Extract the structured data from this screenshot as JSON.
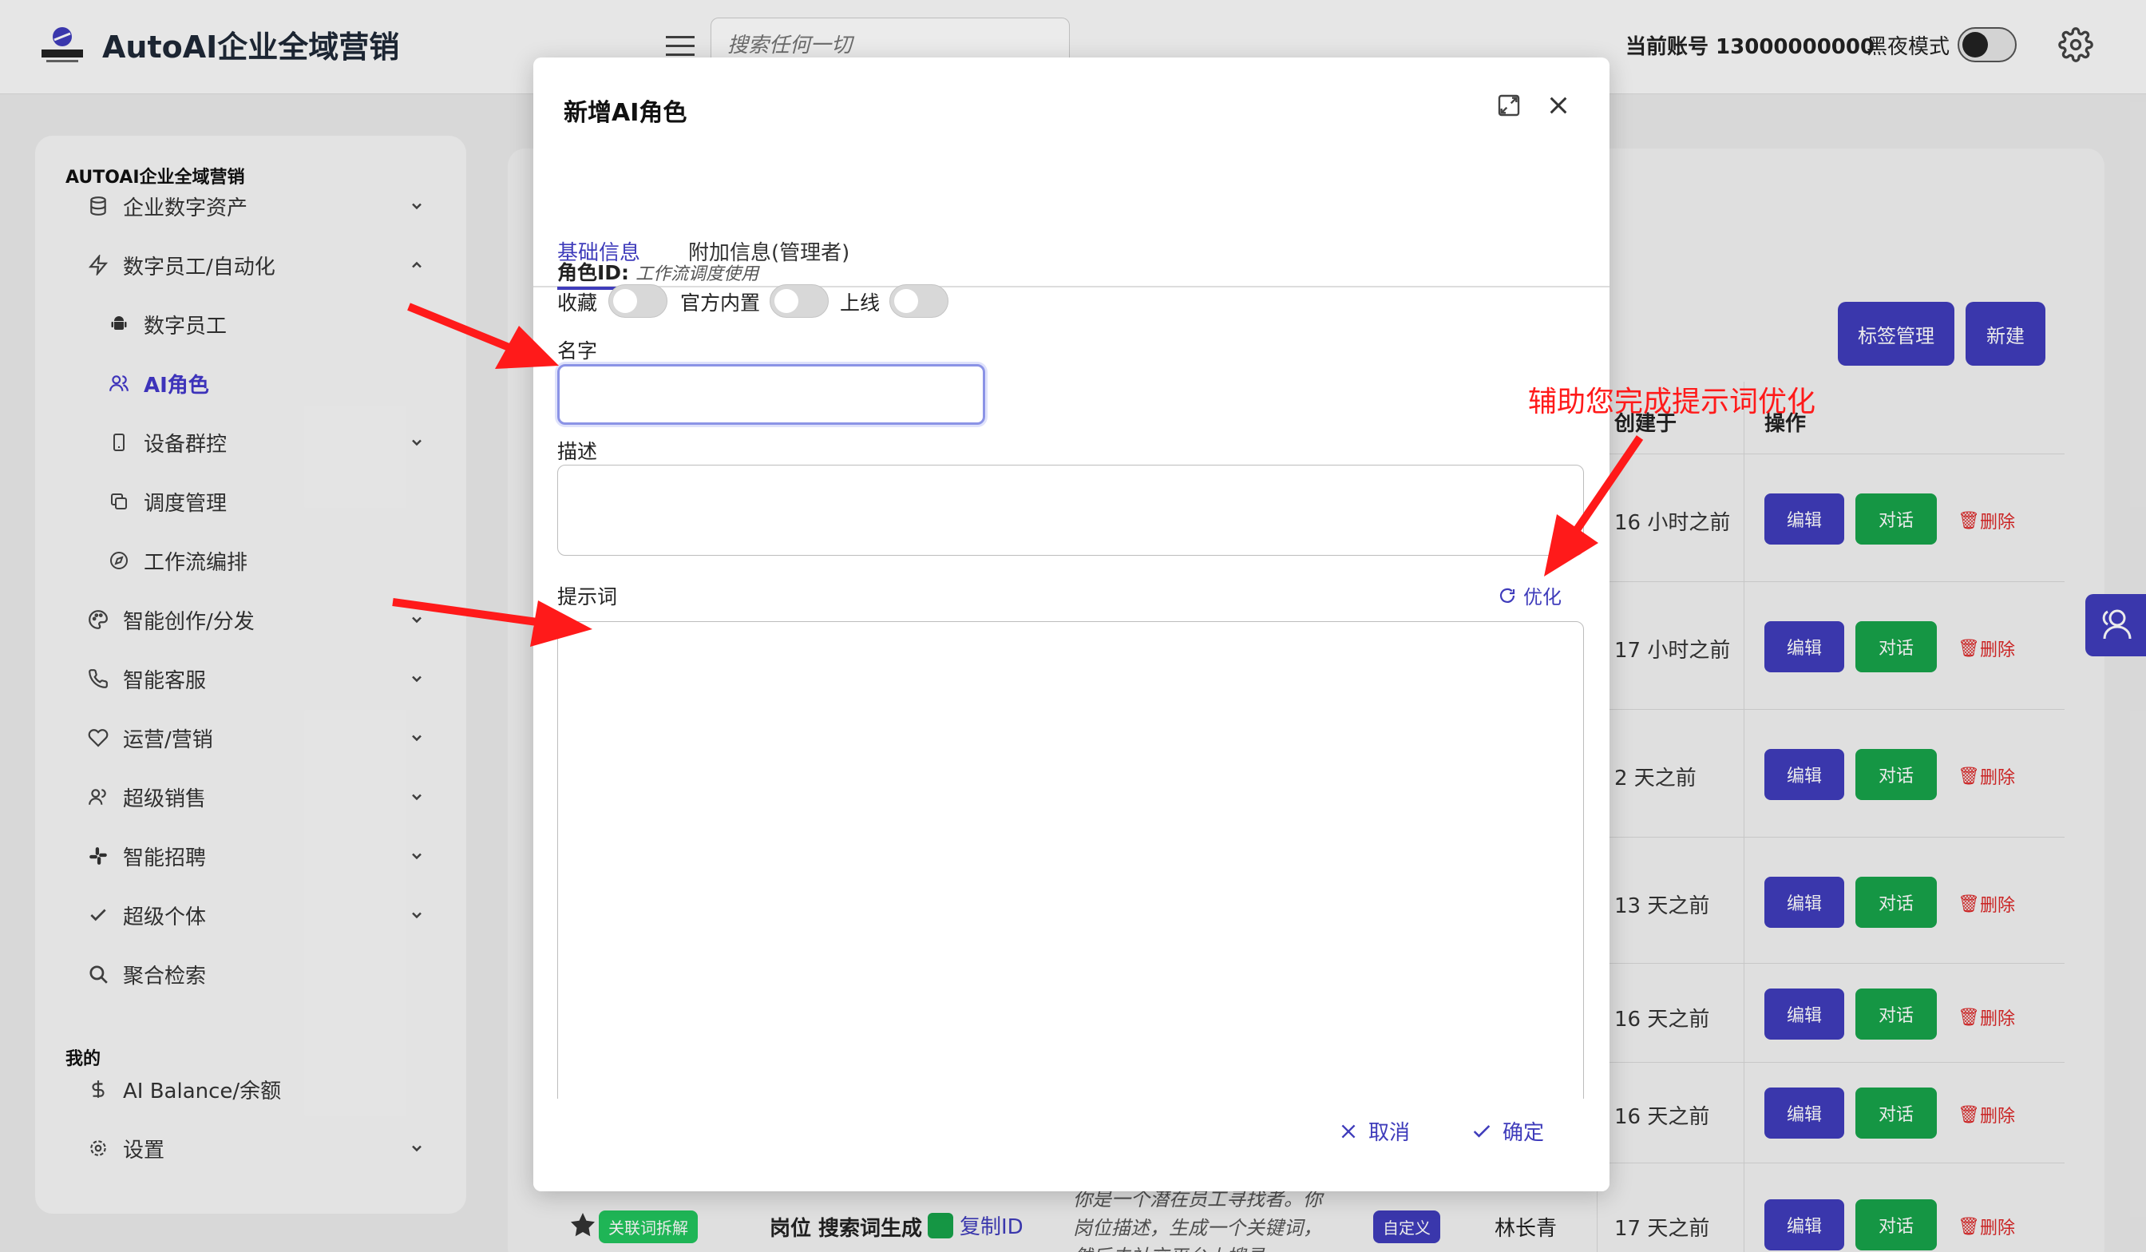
{
  "header": {
    "app_title": "AutoAI企业全域营销",
    "search_placeholder": "搜索任何一切",
    "account_label": "当前账号 13000000000",
    "dark_mode_label": "黑夜模式",
    "dark_mode_on": false
  },
  "sidebar": {
    "section_main": "AUTOAI企业全域营销",
    "section_mine": "我的",
    "items": [
      {
        "label": "企业数字资产",
        "icon": "database-icon",
        "expand": "down"
      },
      {
        "label": "数字员工/自动化",
        "icon": "bolt-icon",
        "expand": "up"
      },
      {
        "label": "数字员工",
        "icon": "android-icon",
        "sub": true
      },
      {
        "label": "AI角色",
        "icon": "users-icon",
        "sub": true,
        "active": true
      },
      {
        "label": "设备群控",
        "icon": "phone-icon",
        "sub": true,
        "expand": "down"
      },
      {
        "label": "调度管理",
        "icon": "copy-icon",
        "sub": true
      },
      {
        "label": "工作流编排",
        "icon": "compass-icon",
        "sub": true
      },
      {
        "label": "智能创作/分发",
        "icon": "palette-icon",
        "expand": "down"
      },
      {
        "label": "智能客服",
        "icon": "phone-call-icon",
        "expand": "down"
      },
      {
        "label": "运营/营销",
        "icon": "heart-icon",
        "expand": "down"
      },
      {
        "label": "超级销售",
        "icon": "users-icon",
        "expand": "down"
      },
      {
        "label": "智能招聘",
        "icon": "slack-icon",
        "expand": "down"
      },
      {
        "label": "超级个体",
        "icon": "check-icon",
        "expand": "down"
      },
      {
        "label": "聚合检索",
        "icon": "search-icon"
      }
    ],
    "mine_items": [
      {
        "label": "AI Balance/余额",
        "icon": "dollar-icon"
      },
      {
        "label": "设置",
        "icon": "gear-icon",
        "expand": "down"
      }
    ]
  },
  "table": {
    "tag_button": "标签管理",
    "new_button": "新建",
    "col_created": "创建于",
    "col_actions": "操作",
    "edit_label": "编辑",
    "chat_label": "对话",
    "delete_label": "删除",
    "times": [
      "16 小时之前",
      "17 小时之前",
      "2 天之前",
      "13 天之前",
      "16 天之前",
      "16 天之前",
      "17 天之前"
    ],
    "bottom_row": {
      "chip": "关联词拆解",
      "title": "岗位 搜索词生成",
      "copy_id": "复制ID",
      "desc": "你是一个潜在员工寻找者。你岗位描述，生成一个关键词，然后去社交平台上搜寻",
      "type_chip": "自定义",
      "creator": "林长青"
    }
  },
  "modal": {
    "title": "新增AI角色",
    "tabs": [
      "基础信息",
      "附加信息(管理者)"
    ],
    "role_id_label": "角色ID:",
    "role_id_hint": "工作流调度使用",
    "fav_label": "收藏",
    "official_label": "官方内置",
    "online_label": "上线",
    "name_label": "名字",
    "name_value": "",
    "desc_label": "描述",
    "desc_value": "",
    "prompt_label": "提示词",
    "prompt_value": "",
    "optimize_label": "优化",
    "cancel_label": "取消",
    "ok_label": "确定"
  },
  "annotation": {
    "text": "辅助您完成提示词优化",
    "color": "#ff1a1a"
  },
  "colors": {
    "accent": "#3f3cbb",
    "success": "#17a34a",
    "danger": "#dc2626"
  }
}
